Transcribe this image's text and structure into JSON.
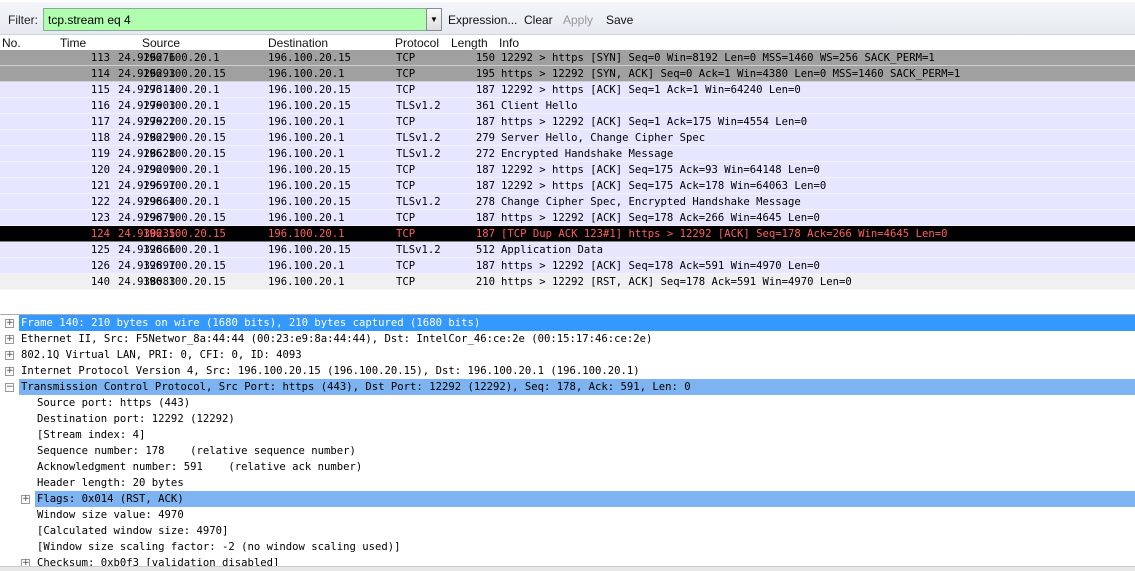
{
  "toolbar": {
    "filter_label": "Filter:",
    "filter_value": "tcp.stream eq 4",
    "expression": "Expression...",
    "clear": "Clear",
    "apply": "Apply",
    "save": "Save"
  },
  "columns": {
    "no": "No.",
    "time": "Time",
    "source": "Source",
    "destination": "Destination",
    "protocol": "Protocol",
    "length": "Length",
    "info": "Info"
  },
  "colors": {
    "syn": "#a0a0a0",
    "tcp": "#e7e6ff",
    "bad": "#000000",
    "bad_text": "#ff5f5f",
    "rst": "#f0f0f0",
    "filter_bg": "#afffaf",
    "detail_sel": "#7eb3f2",
    "frame_sel": "#3399ff"
  },
  "packets": [
    {
      "no": "113",
      "time": "24.926276",
      "src": "196.100.20.1",
      "dst": "196.100.20.15",
      "proto": "TCP",
      "len": "150",
      "info": "12292 > https [SYN] Seq=0 Win=8192 Len=0 MSS=1460 WS=256 SACK_PERM=1",
      "style": "syn"
    },
    {
      "no": "114",
      "time": "24.926293",
      "src": "196.100.20.15",
      "dst": "196.100.20.1",
      "proto": "TCP",
      "len": "195",
      "info": "https > 12292 [SYN, ACK] Seq=0 Ack=1 Win=4380 Len=0 MSS=1460 SACK_PERM=1",
      "style": "syn"
    },
    {
      "no": "115",
      "time": "24.927314",
      "src": "196.100.20.1",
      "dst": "196.100.20.15",
      "proto": "TCP",
      "len": "187",
      "info": "12292 > https [ACK] Seq=1 Ack=1 Win=64240 Len=0",
      "style": "tcp"
    },
    {
      "no": "116",
      "time": "24.927903",
      "src": "196.100.20.1",
      "dst": "196.100.20.15",
      "proto": "TLSv1.2",
      "len": "361",
      "info": "Client Hello",
      "style": "tcp"
    },
    {
      "no": "117",
      "time": "24.927922",
      "src": "196.100.20.15",
      "dst": "196.100.20.1",
      "proto": "TCP",
      "len": "187",
      "info": "https > 12292 [ACK] Seq=1 Ack=175 Win=4554 Len=0",
      "style": "tcp"
    },
    {
      "no": "118",
      "time": "24.928229",
      "src": "196.100.20.15",
      "dst": "196.100.20.1",
      "proto": "TLSv1.2",
      "len": "279",
      "info": "Server Hello, Change Cipher Spec",
      "style": "tcp"
    },
    {
      "no": "119",
      "time": "24.928628",
      "src": "196.100.20.15",
      "dst": "196.100.20.1",
      "proto": "TLSv1.2",
      "len": "272",
      "info": "Encrypted Handshake Message",
      "style": "tcp"
    },
    {
      "no": "120",
      "time": "24.929209",
      "src": "196.100.20.1",
      "dst": "196.100.20.15",
      "proto": "TCP",
      "len": "187",
      "info": "12292 > https [ACK] Seq=175 Ack=93 Win=64148 Len=0",
      "style": "tcp"
    },
    {
      "no": "121",
      "time": "24.929597",
      "src": "196.100.20.1",
      "dst": "196.100.20.15",
      "proto": "TCP",
      "len": "187",
      "info": "12292 > https [ACK] Seq=175 Ack=178 Win=64063 Len=0",
      "style": "tcp"
    },
    {
      "no": "122",
      "time": "24.929864",
      "src": "196.100.20.1",
      "dst": "196.100.20.15",
      "proto": "TLSv1.2",
      "len": "278",
      "info": "Change Cipher Spec, Encrypted Handshake Message",
      "style": "tcp"
    },
    {
      "no": "123",
      "time": "24.929879",
      "src": "196.100.20.15",
      "dst": "196.100.20.1",
      "proto": "TCP",
      "len": "187",
      "info": "https > 12292 [ACK] Seq=178 Ack=266 Win=4645 Len=0",
      "style": "tcp"
    },
    {
      "no": "124",
      "time": "24.930235",
      "src": "196.100.20.15",
      "dst": "196.100.20.1",
      "proto": "TCP",
      "len": "187",
      "info": "[TCP Dup ACK 123#1] https > 12292 [ACK] Seq=178 Ack=266 Win=4645 Len=0",
      "style": "bad"
    },
    {
      "no": "125",
      "time": "24.932866",
      "src": "196.100.20.1",
      "dst": "196.100.20.15",
      "proto": "TLSv1.2",
      "len": "512",
      "info": "Application Data",
      "style": "tcp"
    },
    {
      "no": "126",
      "time": "24.932897",
      "src": "196.100.20.15",
      "dst": "196.100.20.1",
      "proto": "TCP",
      "len": "187",
      "info": "https > 12292 [ACK] Seq=178 Ack=591 Win=4970 Len=0",
      "style": "tcp"
    },
    {
      "no": "140",
      "time": "24.938083",
      "src": "196.100.20.15",
      "dst": "196.100.20.1",
      "proto": "TCP",
      "len": "210",
      "info": "https > 12292 [RST, ACK] Seq=178 Ack=591 Win=4970 Len=0",
      "style": "rst"
    }
  ],
  "details": [
    {
      "text": "Frame 140: 210 bytes on wire (1680 bits), 210 bytes captured (1680 bits)",
      "level": 0,
      "expander": "+",
      "sel": "frame"
    },
    {
      "text": "Ethernet II, Src: F5Networ_8a:44:44 (00:23:e9:8a:44:44), Dst: IntelCor_46:ce:2e (00:15:17:46:ce:2e)",
      "level": 0,
      "expander": "+"
    },
    {
      "text": "802.1Q Virtual LAN, PRI: 0, CFI: 0, ID: 4093",
      "level": 0,
      "expander": "+"
    },
    {
      "text": "Internet Protocol Version 4, Src: 196.100.20.15 (196.100.20.15), Dst: 196.100.20.1 (196.100.20.1)",
      "level": 0,
      "expander": "+"
    },
    {
      "text": "Transmission Control Protocol, Src Port: https (443), Dst Port: 12292 (12292), Seq: 178, Ack: 591, Len: 0",
      "level": 0,
      "expander": "−",
      "sel": "light"
    },
    {
      "text": "Source port: https (443)",
      "level": 1
    },
    {
      "text": "Destination port: 12292 (12292)",
      "level": 1
    },
    {
      "text": "[Stream index: 4]",
      "level": 1
    },
    {
      "text": "Sequence number: 178    (relative sequence number)",
      "level": 1
    },
    {
      "text": "Acknowledgment number: 591    (relative ack number)",
      "level": 1
    },
    {
      "text": "Header length: 20 bytes",
      "level": 1
    },
    {
      "text": "Flags: 0x014 (RST, ACK)",
      "level": 1,
      "expander": "+",
      "sel": "light"
    },
    {
      "text": "Window size value: 4970",
      "level": 1
    },
    {
      "text": "[Calculated window size: 4970]",
      "level": 1
    },
    {
      "text": "[Window size scaling factor: -2 (no window scaling used)]",
      "level": 1
    },
    {
      "text": "Checksum: 0xb0f3 [validation disabled]",
      "level": 1,
      "expander": "+"
    }
  ]
}
